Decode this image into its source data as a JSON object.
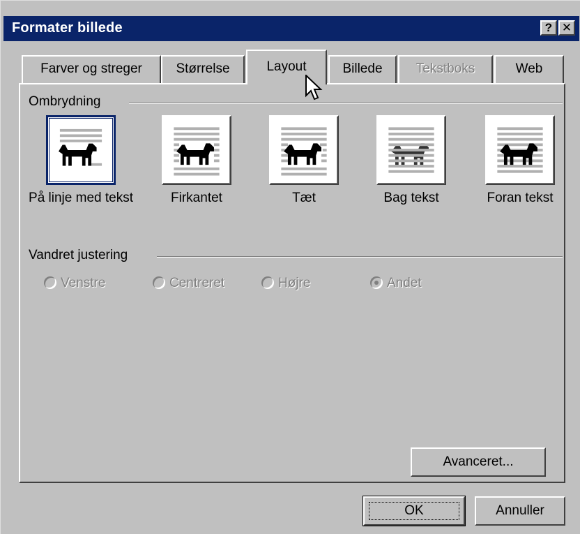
{
  "window": {
    "title": "Formater billede",
    "help_button": "?",
    "close_button": "✕"
  },
  "tabs": [
    {
      "label": "Farver og streger",
      "state": "normal"
    },
    {
      "label": "Størrelse",
      "state": "normal"
    },
    {
      "label": "Layout",
      "state": "active"
    },
    {
      "label": "Billede",
      "state": "normal"
    },
    {
      "label": "Tekstboks",
      "state": "disabled"
    },
    {
      "label": "Web",
      "state": "normal"
    }
  ],
  "wrapping": {
    "group_label": "Ombrydning",
    "options": [
      {
        "label": "På linje med tekst",
        "icon": "inline-with-text-icon",
        "selected": true
      },
      {
        "label": "Firkantet",
        "icon": "square-wrap-icon",
        "selected": false
      },
      {
        "label": "Tæt",
        "icon": "tight-wrap-icon",
        "selected": false
      },
      {
        "label": "Bag tekst",
        "icon": "behind-text-icon",
        "selected": false
      },
      {
        "label": "Foran tekst",
        "icon": "in-front-of-text-icon",
        "selected": false
      }
    ]
  },
  "alignment": {
    "group_label": "Vandret justering",
    "options": [
      {
        "label": "Venstre",
        "checked": false,
        "enabled": false
      },
      {
        "label": "Centreret",
        "checked": false,
        "enabled": false
      },
      {
        "label": "Højre",
        "checked": false,
        "enabled": false
      },
      {
        "label": "Andet",
        "checked": true,
        "enabled": false
      }
    ]
  },
  "buttons": {
    "advanced": "Avanceret...",
    "ok": "OK",
    "cancel": "Annuller"
  },
  "colors": {
    "titlebar": "#0a2469",
    "face": "#c0c0c0",
    "disabled_text": "#808080"
  }
}
